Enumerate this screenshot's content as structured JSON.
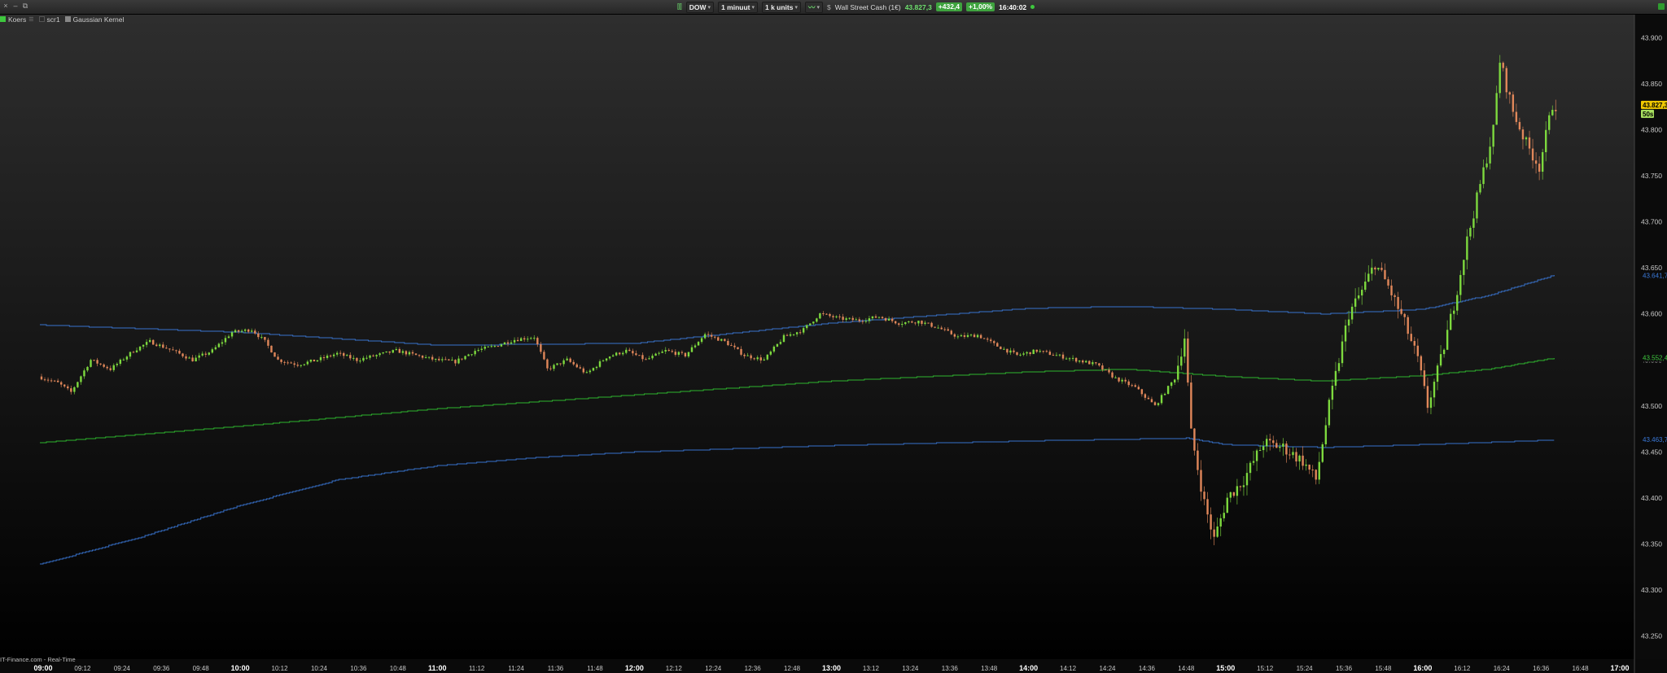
{
  "toolbar": {
    "instrument": "DOW",
    "interval": "1 minuut",
    "units": "1 k units",
    "instrument_name": "Wall Street Cash (1€)",
    "last": "43.827,3",
    "change": "+432,4",
    "change_pct": "+1,00%",
    "time": "16:40:02"
  },
  "legend": {
    "items": [
      {
        "label": "Koers",
        "color": "#3ec83e"
      },
      {
        "label": "scr1",
        "color": "#2a2a2a"
      },
      {
        "label": "Gaussian Kernel",
        "color": "#888888"
      }
    ]
  },
  "footer": {
    "source": "IT-Finance.com - Real-Time"
  },
  "colors": {
    "up": "#7dd93e",
    "down": "#e0875a",
    "band": "#3a78d8",
    "mid": "#2fbf2f",
    "label_last_bg": "#f0c800"
  },
  "chart_data": {
    "type": "candlestick",
    "y_range": [
      43225,
      43925
    ],
    "y_ticks": [
      "43.900",
      "43.850",
      "43.800",
      "43.750",
      "43.700",
      "43.650",
      "43.600",
      "43.550",
      "43.500",
      "43.450",
      "43.400",
      "43.350",
      "43.300",
      "43.250"
    ],
    "x_labels": [
      {
        "t": "09:00",
        "major": true
      },
      {
        "t": "09:12"
      },
      {
        "t": "09:24"
      },
      {
        "t": "09:36"
      },
      {
        "t": "09:48"
      },
      {
        "t": "10:00",
        "major": true
      },
      {
        "t": "10:12"
      },
      {
        "t": "10:24"
      },
      {
        "t": "10:36"
      },
      {
        "t": "10:48"
      },
      {
        "t": "11:00",
        "major": true
      },
      {
        "t": "11:12"
      },
      {
        "t": "11:24"
      },
      {
        "t": "11:36"
      },
      {
        "t": "11:48"
      },
      {
        "t": "12:00",
        "major": true
      },
      {
        "t": "12:12"
      },
      {
        "t": "12:24"
      },
      {
        "t": "12:36"
      },
      {
        "t": "12:48"
      },
      {
        "t": "13:00",
        "major": true
      },
      {
        "t": "13:12"
      },
      {
        "t": "13:24"
      },
      {
        "t": "13:36"
      },
      {
        "t": "13:48"
      },
      {
        "t": "14:00",
        "major": true
      },
      {
        "t": "14:12"
      },
      {
        "t": "14:24"
      },
      {
        "t": "14:36"
      },
      {
        "t": "14:48"
      },
      {
        "t": "15:00",
        "major": true
      },
      {
        "t": "15:12"
      },
      {
        "t": "15:24"
      },
      {
        "t": "15:36"
      },
      {
        "t": "15:48"
      },
      {
        "t": "16:00",
        "major": true
      },
      {
        "t": "16:12"
      },
      {
        "t": "16:24"
      },
      {
        "t": "16:36"
      },
      {
        "t": "16:48"
      },
      {
        "t": "17:00",
        "major": true
      }
    ],
    "price_path": [
      [
        "08:59",
        43532
      ],
      [
        "09:05",
        43525
      ],
      [
        "09:09",
        43515
      ],
      [
        "09:15",
        43550
      ],
      [
        "09:21",
        43540
      ],
      [
        "09:28",
        43560
      ],
      [
        "09:33",
        43570
      ],
      [
        "09:40",
        43560
      ],
      [
        "09:46",
        43550
      ],
      [
        "09:52",
        43560
      ],
      [
        "09:58",
        43580
      ],
      [
        "10:04",
        43583
      ],
      [
        "10:08",
        43570
      ],
      [
        "10:12",
        43550
      ],
      [
        "10:18",
        43545
      ],
      [
        "10:24",
        43550
      ],
      [
        "10:30",
        43557
      ],
      [
        "10:36",
        43550
      ],
      [
        "10:42",
        43555
      ],
      [
        "10:48",
        43560
      ],
      [
        "10:54",
        43555
      ],
      [
        "11:00",
        43550
      ],
      [
        "11:06",
        43548
      ],
      [
        "11:12",
        43560
      ],
      [
        "11:18",
        43565
      ],
      [
        "11:24",
        43572
      ],
      [
        "11:30",
        43575
      ],
      [
        "11:34",
        43540
      ],
      [
        "11:40",
        43550
      ],
      [
        "11:46",
        43535
      ],
      [
        "11:52",
        43553
      ],
      [
        "11:58",
        43560
      ],
      [
        "12:04",
        43550
      ],
      [
        "12:10",
        43560
      ],
      [
        "12:16",
        43555
      ],
      [
        "12:22",
        43578
      ],
      [
        "12:28",
        43570
      ],
      [
        "12:34",
        43555
      ],
      [
        "12:40",
        43550
      ],
      [
        "12:46",
        43575
      ],
      [
        "12:52",
        43583
      ],
      [
        "12:57",
        43600
      ],
      [
        "13:03",
        43595
      ],
      [
        "13:09",
        43593
      ],
      [
        "13:15",
        43597
      ],
      [
        "13:21",
        43590
      ],
      [
        "13:27",
        43592
      ],
      [
        "13:33",
        43585
      ],
      [
        "13:39",
        43575
      ],
      [
        "13:45",
        43577
      ],
      [
        "13:51",
        43565
      ],
      [
        "13:57",
        43555
      ],
      [
        "14:03",
        43560
      ],
      [
        "14:09",
        43555
      ],
      [
        "14:15",
        43550
      ],
      [
        "14:21",
        43545
      ],
      [
        "14:27",
        43530
      ],
      [
        "14:33",
        43520
      ],
      [
        "14:39",
        43500
      ],
      [
        "14:45",
        43530
      ],
      [
        "14:48",
        43575
      ],
      [
        "14:50",
        43470
      ],
      [
        "14:54",
        43395
      ],
      [
        "14:57",
        43355
      ],
      [
        "15:01",
        43400
      ],
      [
        "15:06",
        43420
      ],
      [
        "15:12",
        43460
      ],
      [
        "15:18",
        43455
      ],
      [
        "15:24",
        43440
      ],
      [
        "15:28",
        43420
      ],
      [
        "15:32",
        43500
      ],
      [
        "15:38",
        43600
      ],
      [
        "15:42",
        43625
      ],
      [
        "15:46",
        43655
      ],
      [
        "15:50",
        43630
      ],
      [
        "15:55",
        43590
      ],
      [
        "15:59",
        43550
      ],
      [
        "16:02",
        43500
      ],
      [
        "16:06",
        43550
      ],
      [
        "16:10",
        43610
      ],
      [
        "16:14",
        43680
      ],
      [
        "16:18",
        43740
      ],
      [
        "16:22",
        43800
      ],
      [
        "16:24",
        43875
      ],
      [
        "16:28",
        43820
      ],
      [
        "16:32",
        43785
      ],
      [
        "16:36",
        43760
      ],
      [
        "16:40",
        43827
      ]
    ],
    "series": [
      {
        "name": "Gaussian Kernel (upper)",
        "points": [
          [
            "08:59",
            43588
          ],
          [
            "10:00",
            43580
          ],
          [
            "11:00",
            43566
          ],
          [
            "12:00",
            43568
          ],
          [
            "13:00",
            43590
          ],
          [
            "14:00",
            43606
          ],
          [
            "14:30",
            43608
          ],
          [
            "15:00",
            43605
          ],
          [
            "15:30",
            43600
          ],
          [
            "16:00",
            43605
          ],
          [
            "16:20",
            43620
          ],
          [
            "16:40",
            43642
          ]
        ]
      },
      {
        "name": "Gaussian Kernel (mid)",
        "points": [
          [
            "08:59",
            43460
          ],
          [
            "10:00",
            43478
          ],
          [
            "11:00",
            43497
          ],
          [
            "12:00",
            43512
          ],
          [
            "13:00",
            43527
          ],
          [
            "14:00",
            43537
          ],
          [
            "14:30",
            43540
          ],
          [
            "15:00",
            43532
          ],
          [
            "15:30",
            43527
          ],
          [
            "16:00",
            43533
          ],
          [
            "16:20",
            43540
          ],
          [
            "16:40",
            43552
          ]
        ]
      },
      {
        "name": "Gaussian Kernel (lower)",
        "points": [
          [
            "08:59",
            43328
          ],
          [
            "09:30",
            43358
          ],
          [
            "10:00",
            43392
          ],
          [
            "10:30",
            43420
          ],
          [
            "11:00",
            43435
          ],
          [
            "11:30",
            43444
          ],
          [
            "12:00",
            43450
          ],
          [
            "13:00",
            43457
          ],
          [
            "14:00",
            43462
          ],
          [
            "14:48",
            43465
          ],
          [
            "15:00",
            43458
          ],
          [
            "15:30",
            43455
          ],
          [
            "16:00",
            43458
          ],
          [
            "16:40",
            43463
          ]
        ]
      }
    ],
    "price_labels": [
      {
        "text": "43.827,3",
        "value": 43827,
        "kind": "last"
      },
      {
        "text": "50s",
        "value": 43817,
        "kind": "timer"
      },
      {
        "text": "43.641,7",
        "value": 43641.7,
        "kind": "upper"
      },
      {
        "text": "43.552,4",
        "value": 43552.4,
        "kind": "mid"
      },
      {
        "text": "43.463,7",
        "value": 43463.7,
        "kind": "lower"
      }
    ]
  }
}
